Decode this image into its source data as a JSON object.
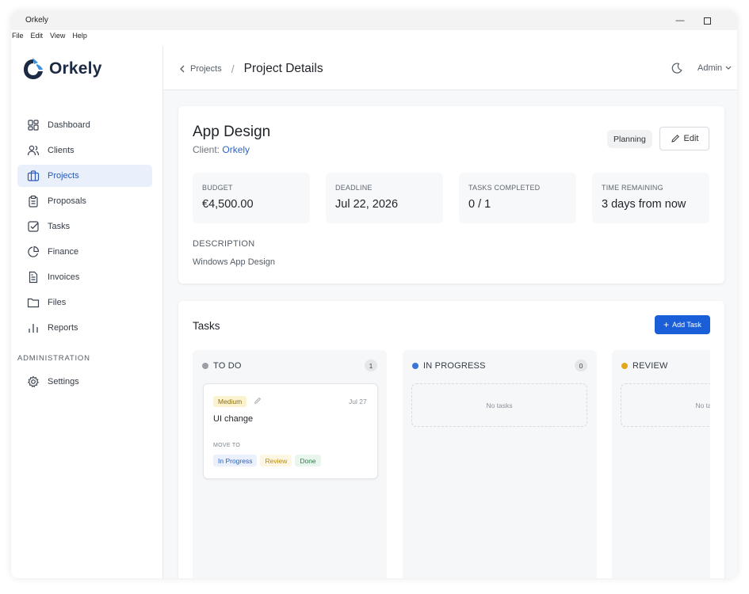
{
  "window": {
    "title": "Orkely"
  },
  "menu": [
    "File",
    "Edit",
    "View",
    "Help"
  ],
  "sidebar": {
    "brand": "Orkely",
    "items": [
      {
        "label": "Dashboard",
        "icon": "dashboard-icon"
      },
      {
        "label": "Clients",
        "icon": "users-icon"
      },
      {
        "label": "Projects",
        "icon": "briefcase-icon",
        "active": true
      },
      {
        "label": "Proposals",
        "icon": "clipboard-icon"
      },
      {
        "label": "Tasks",
        "icon": "checkbox-icon"
      },
      {
        "label": "Finance",
        "icon": "pie-chart-icon"
      },
      {
        "label": "Invoices",
        "icon": "document-icon"
      },
      {
        "label": "Files",
        "icon": "folder-icon"
      },
      {
        "label": "Reports",
        "icon": "bar-chart-icon"
      }
    ],
    "admin_label": "ADMINISTRATION",
    "settings_label": "Settings"
  },
  "topbar": {
    "breadcrumb_parent": "Projects",
    "breadcrumb_current": "Project Details",
    "user": "Admin"
  },
  "project": {
    "title": "App Design",
    "client_prefix": "Client:",
    "client_name": "Orkely",
    "status": "Planning",
    "edit_label": "Edit",
    "stats": [
      {
        "label": "BUDGET",
        "value": "€4,500.00"
      },
      {
        "label": "DEADLINE",
        "value": "Jul 22, 2026"
      },
      {
        "label": "TASKS COMPLETED",
        "value": "0 / 1"
      },
      {
        "label": "TIME REMAINING",
        "value": "3 days from now"
      }
    ],
    "description_label": "DESCRIPTION",
    "description": "Windows App Design"
  },
  "tasks": {
    "title": "Tasks",
    "add_label": "Add Task",
    "columns": [
      {
        "name": "TO DO",
        "count": "1",
        "color": "#9aa0a6"
      },
      {
        "name": "IN PROGRESS",
        "count": "0",
        "color": "#3b74d9",
        "empty": "No tasks"
      },
      {
        "name": "REVIEW",
        "count": "",
        "color": "#e0a81a",
        "empty": "No tasks"
      }
    ],
    "card": {
      "priority": "Medium",
      "date": "Jul 27",
      "title": "UI change",
      "move_to": "MOVE TO",
      "actions": [
        "In Progress",
        "Review",
        "Done"
      ]
    }
  },
  "colors": {
    "accent": "#1a5ed8",
    "active_nav_bg": "#e9f0fb"
  }
}
